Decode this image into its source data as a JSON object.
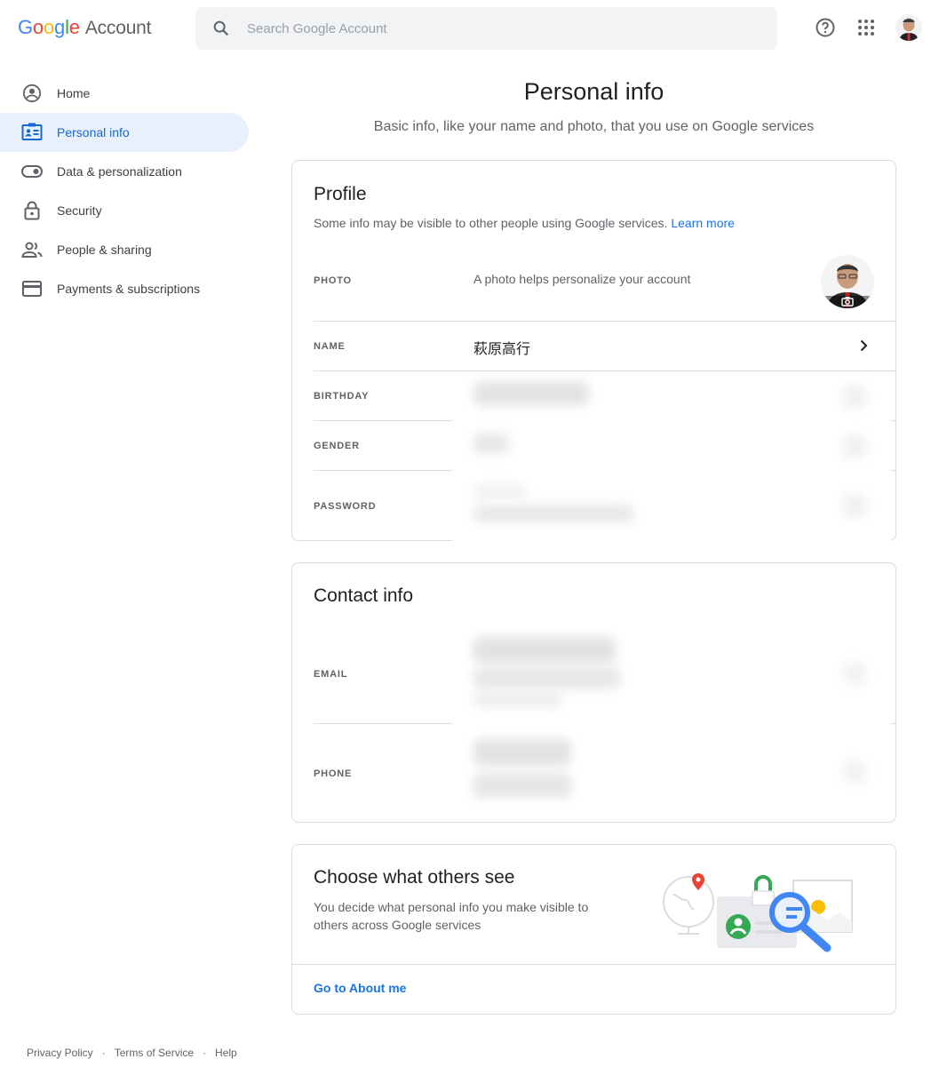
{
  "header": {
    "logo_google": [
      "G",
      "o",
      "o",
      "g",
      "l",
      "e"
    ],
    "logo_account": "Account",
    "search_placeholder": "Search Google Account"
  },
  "sidebar": {
    "items": [
      {
        "label": "Home",
        "icon": "account-circle-icon"
      },
      {
        "label": "Personal info",
        "icon": "id-card-icon",
        "active": true
      },
      {
        "label": "Data & personalization",
        "icon": "toggle-icon"
      },
      {
        "label": "Security",
        "icon": "lock-icon"
      },
      {
        "label": "People & sharing",
        "icon": "people-icon"
      },
      {
        "label": "Payments & subscriptions",
        "icon": "credit-card-icon"
      }
    ]
  },
  "main": {
    "title": "Personal info",
    "subtitle": "Basic info, like your name and photo, that you use on Google services"
  },
  "profile": {
    "title": "Profile",
    "desc": "Some info may be visible to other people using Google services.",
    "learn_more": "Learn more",
    "photo_label": "PHOTO",
    "photo_value": "A photo helps personalize your account",
    "name_label": "NAME",
    "name_value": "萩原高行",
    "birthday_label": "BIRTHDAY",
    "gender_label": "GENDER",
    "password_label": "PASSWORD"
  },
  "contact": {
    "title": "Contact info",
    "email_label": "EMAIL",
    "phone_label": "PHONE"
  },
  "about": {
    "title": "Choose what others see",
    "desc": "You decide what personal info you make visible to others across Google services",
    "link": "Go to About me"
  },
  "footer": {
    "privacy": "Privacy Policy",
    "terms": "Terms of Service",
    "help": "Help",
    "separator": "·"
  },
  "colors": {
    "accent": "#1a73e8",
    "active_bg": "#e8f0fe",
    "active_text": "#1967d2",
    "border": "#dadce0"
  }
}
